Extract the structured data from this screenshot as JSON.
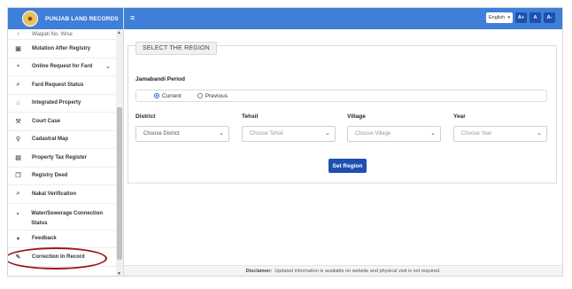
{
  "app": {
    "title": "PUNJAB LAND RECORDS"
  },
  "sidebar": {
    "items": [
      {
        "label": "Waqiati No. Wise",
        "icon": "chevron-right-icon",
        "icon_glyph": "›"
      },
      {
        "label": "Mutation After Registry",
        "icon": "briefcase-icon",
        "icon_glyph": "▣"
      },
      {
        "label": "Online Request for Fard",
        "icon": "drop-icon",
        "icon_glyph": "⬩"
      },
      {
        "label": "Fard Request Status",
        "icon": "search-icon",
        "icon_glyph": "⌕"
      },
      {
        "label": "Integrated Property",
        "icon": "bank-icon",
        "icon_glyph": "⌂"
      },
      {
        "label": "Court Case",
        "icon": "gavel-icon",
        "icon_glyph": "⚒"
      },
      {
        "label": "Cadastral Map",
        "icon": "map-marker-icon",
        "icon_glyph": "⚲"
      },
      {
        "label": "Property Tax Register",
        "icon": "register-icon",
        "icon_glyph": "▤"
      },
      {
        "label": "Registry Deed",
        "icon": "document-icon",
        "icon_glyph": "❐"
      },
      {
        "label": "Nakal Verification",
        "icon": "search-icon",
        "icon_glyph": "⌕"
      },
      {
        "label": "Water/Sewerage Connection Status",
        "icon": "water-drop-icon",
        "icon_glyph": "⬩"
      },
      {
        "label": "Feedback",
        "icon": "chat-icon",
        "icon_glyph": "●"
      },
      {
        "label": "Correction In Record",
        "icon": "edit-icon",
        "icon_glyph": "✎"
      }
    ],
    "online_fard_chevron": "⌄"
  },
  "topbar": {
    "menu_icon": "≡",
    "language": "English",
    "font_buttons": [
      "A+",
      "A",
      "A-"
    ]
  },
  "region": {
    "legend": "SELECT THE REGION",
    "period_label": "Jamabandi Period",
    "period_options": [
      "Current",
      "Previous"
    ],
    "period_selected": "Current",
    "fields": {
      "district": {
        "label": "District",
        "value": "Choose District"
      },
      "tehsil": {
        "label": "Tehsil",
        "value": "Choose Tehsil"
      },
      "village": {
        "label": "Village",
        "value": "Choose Village"
      },
      "year": {
        "label": "Year",
        "value": "Choose Year"
      }
    },
    "submit_label": "Set Region"
  },
  "footer": {
    "prefix": "Disclaimer:",
    "text": "Updated information is available on website and physical visit is not required."
  },
  "colors": {
    "brand": "#3f7fd8",
    "button": "#1f4fb0",
    "highlight": "#9c1a1a"
  }
}
